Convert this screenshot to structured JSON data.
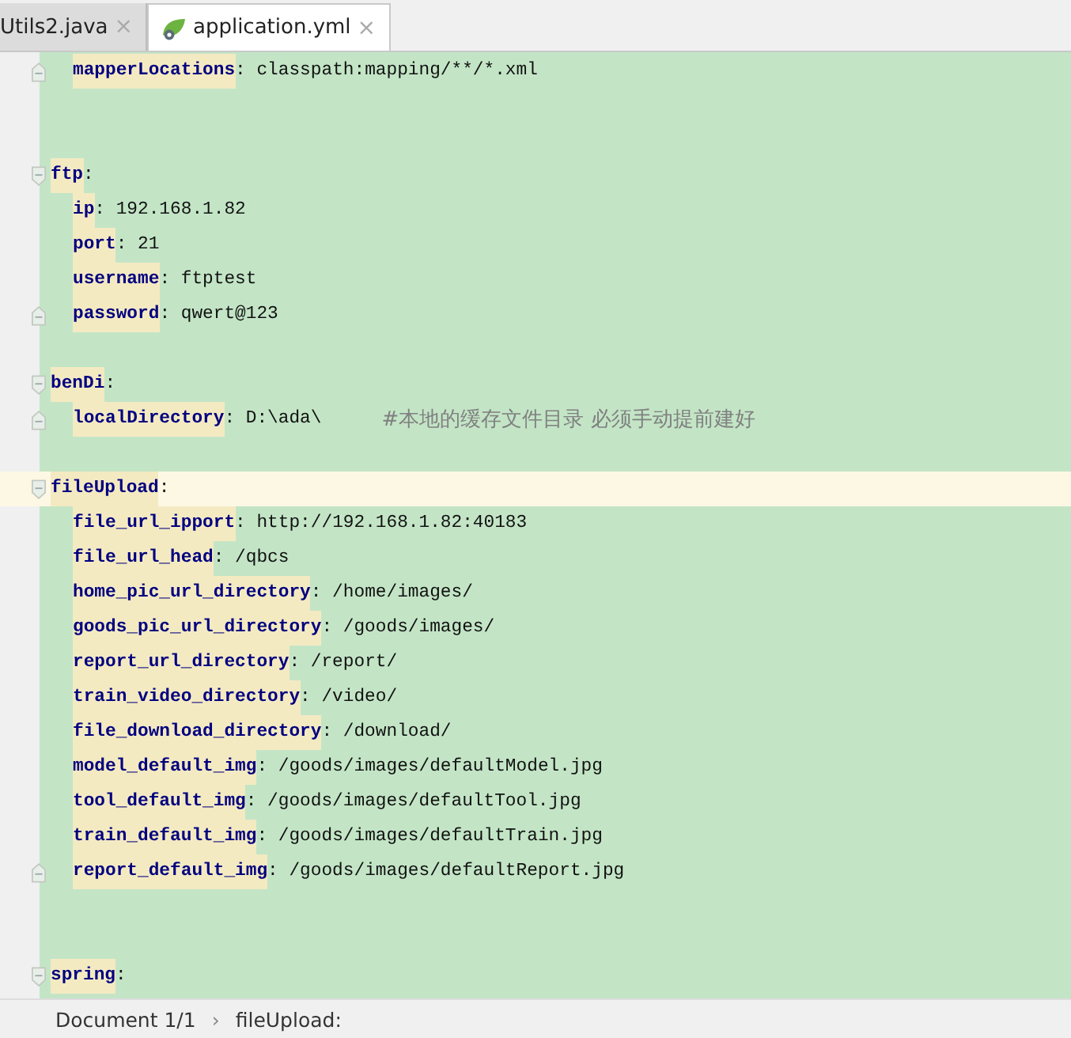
{
  "tabs": [
    {
      "label": "Utils2.java",
      "selected": false,
      "close": "×",
      "kind": "java"
    },
    {
      "label": "application.yml",
      "selected": true,
      "close": "×",
      "kind": "yaml"
    }
  ],
  "editor": {
    "lines": [
      {
        "kind": "nested",
        "children": [
          {
            "kind": "entry",
            "key": "mapperLocations",
            "value": ": classpath:mapping/**/*.xml",
            "fold_end": true
          }
        ]
      },
      {
        "kind": "blank"
      },
      {
        "kind": "blank"
      },
      {
        "kind": "entry",
        "key": "ftp",
        "value": ":",
        "fold_start": true,
        "children": [
          {
            "kind": "entry",
            "key": "ip",
            "value": ": 192.168.1.82"
          },
          {
            "kind": "entry",
            "key": "port",
            "value": ": 21"
          },
          {
            "kind": "entry",
            "key": "username",
            "value": ": ftptest"
          },
          {
            "kind": "entry",
            "key": "password",
            "value": ": qwert@123",
            "fold_end": true
          }
        ]
      },
      {
        "kind": "blank"
      },
      {
        "kind": "entry",
        "key": "benDi",
        "value": ":",
        "fold_start": true,
        "children": [
          {
            "kind": "entry",
            "key": "localDirectory",
            "value": ": D:\\ada\\",
            "comment": "#本地的缓存文件目录 必须手动提前建好",
            "fold_end": true
          }
        ]
      },
      {
        "kind": "blank"
      },
      {
        "kind": "entry",
        "key": "fileUpload",
        "value": ":",
        "fold_start": true,
        "current": true,
        "children": [
          {
            "kind": "entry",
            "key": "file_url_ipport",
            "value": ": http://192.168.1.82:40183"
          },
          {
            "kind": "entry",
            "key": "file_url_head",
            "value": ": /qbcs"
          },
          {
            "kind": "entry",
            "key": "home_pic_url_directory",
            "value": ": /home/images/"
          },
          {
            "kind": "entry",
            "key": "goods_pic_url_directory",
            "value": ": /goods/images/"
          },
          {
            "kind": "entry",
            "key": "report_url_directory",
            "value": ": /report/"
          },
          {
            "kind": "entry",
            "key": "train_video_directory",
            "value": ": /video/"
          },
          {
            "kind": "entry",
            "key": "file_download_directory",
            "value": ": /download/"
          },
          {
            "kind": "entry",
            "key": "model_default_img",
            "value": ": /goods/images/defaultModel.jpg"
          },
          {
            "kind": "entry",
            "key": "tool_default_img",
            "value": ": /goods/images/defaultTool.jpg"
          },
          {
            "kind": "entry",
            "key": "train_default_img",
            "value": ": /goods/images/defaultTrain.jpg"
          },
          {
            "kind": "entry",
            "key": "report_default_img",
            "value": ": /goods/images/defaultReport.jpg",
            "fold_end": true
          }
        ]
      },
      {
        "kind": "blank"
      },
      {
        "kind": "blank"
      },
      {
        "kind": "entry",
        "key": "spring",
        "value": ":",
        "fold_start": true
      }
    ]
  },
  "status_bar": {
    "breadcrumbs": [
      "Document 1/1",
      "fileUpload:"
    ],
    "separator": "›"
  }
}
